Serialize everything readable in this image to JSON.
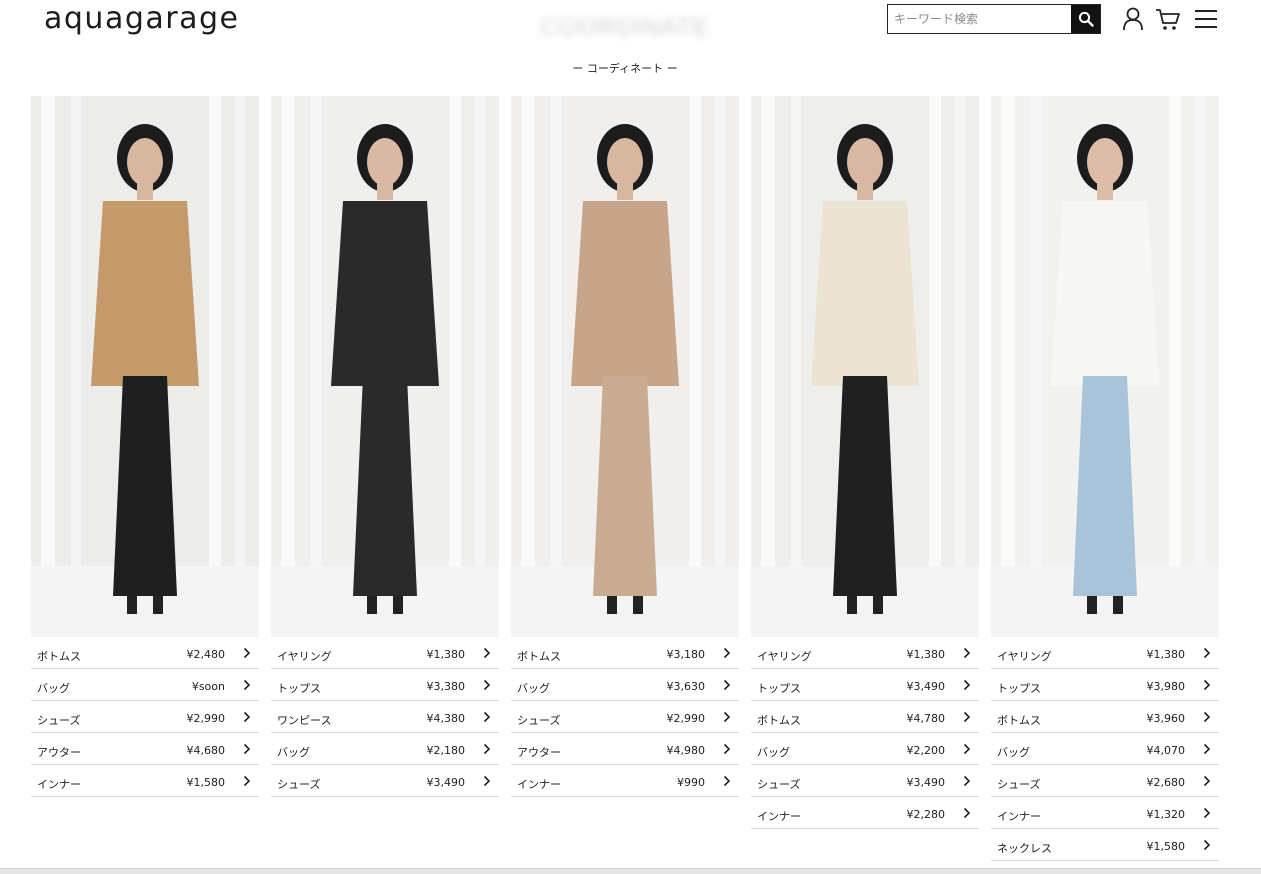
{
  "header": {
    "logo": "aquagarage",
    "title": "COORDINATE",
    "subtitle": "ー コーディネート ー",
    "search_placeholder": "キーワード検索"
  },
  "icons": {
    "search": "search-icon",
    "account": "user-icon",
    "cart": "cart-icon",
    "menu": "hamburger-menu-icon",
    "row_arrow": "chevron-right-icon"
  },
  "colors": {
    "accent": "#111111",
    "divider": "#dcdcdc"
  },
  "coordinates": [
    {
      "palette": {
        "bg": "#ececea",
        "garment": "#c59a6a",
        "dress": "#1f1f1f",
        "skin": "#d7b7a0"
      },
      "items": [
        {
          "category": "ボトムス",
          "price": "¥2,480"
        },
        {
          "category": "バッグ",
          "price": "¥soon"
        },
        {
          "category": "シューズ",
          "price": "¥2,990"
        },
        {
          "category": "アウター",
          "price": "¥4,680"
        },
        {
          "category": "インナー",
          "price": "¥1,580"
        }
      ]
    },
    {
      "palette": {
        "bg": "#efefed",
        "garment": "#2a2a2a",
        "dress": "#2a2a2a",
        "skin": "#d9b9a3"
      },
      "items": [
        {
          "category": "イヤリング",
          "price": "¥1,380"
        },
        {
          "category": "トップス",
          "price": "¥3,380"
        },
        {
          "category": "ワンピース",
          "price": "¥4,380"
        },
        {
          "category": "バッグ",
          "price": "¥2,180"
        },
        {
          "category": "シューズ",
          "price": "¥3,490"
        }
      ]
    },
    {
      "palette": {
        "bg": "#f0efed",
        "garment": "#c7a58a",
        "dress": "#c9ab92",
        "skin": "#d7b7a0"
      },
      "items": [
        {
          "category": "ボトムス",
          "price": "¥3,180"
        },
        {
          "category": "バッグ",
          "price": "¥3,630"
        },
        {
          "category": "シューズ",
          "price": "¥2,990"
        },
        {
          "category": "アウター",
          "price": "¥4,980"
        },
        {
          "category": "インナー",
          "price": "¥990"
        }
      ]
    },
    {
      "palette": {
        "bg": "#eeeeec",
        "garment": "#ece4d2",
        "dress": "#202020",
        "skin": "#d8b8a2"
      },
      "items": [
        {
          "category": "イヤリング",
          "price": "¥1,380"
        },
        {
          "category": "トップス",
          "price": "¥3,490"
        },
        {
          "category": "ボトムス",
          "price": "¥4,780"
        },
        {
          "category": "バッグ",
          "price": "¥2,200"
        },
        {
          "category": "シューズ",
          "price": "¥3,490"
        },
        {
          "category": "インナー",
          "price": "¥2,280"
        }
      ]
    },
    {
      "palette": {
        "bg": "#f1f1ef",
        "garment": "#f7f7f5",
        "dress": "#a9c3d8",
        "skin": "#dcbca6"
      },
      "items": [
        {
          "category": "イヤリング",
          "price": "¥1,380"
        },
        {
          "category": "トップス",
          "price": "¥3,980"
        },
        {
          "category": "ボトムス",
          "price": "¥3,960"
        },
        {
          "category": "バッグ",
          "price": "¥4,070"
        },
        {
          "category": "シューズ",
          "price": "¥2,680"
        },
        {
          "category": "インナー",
          "price": "¥1,320"
        },
        {
          "category": "ネックレス",
          "price": "¥1,580"
        }
      ]
    }
  ]
}
